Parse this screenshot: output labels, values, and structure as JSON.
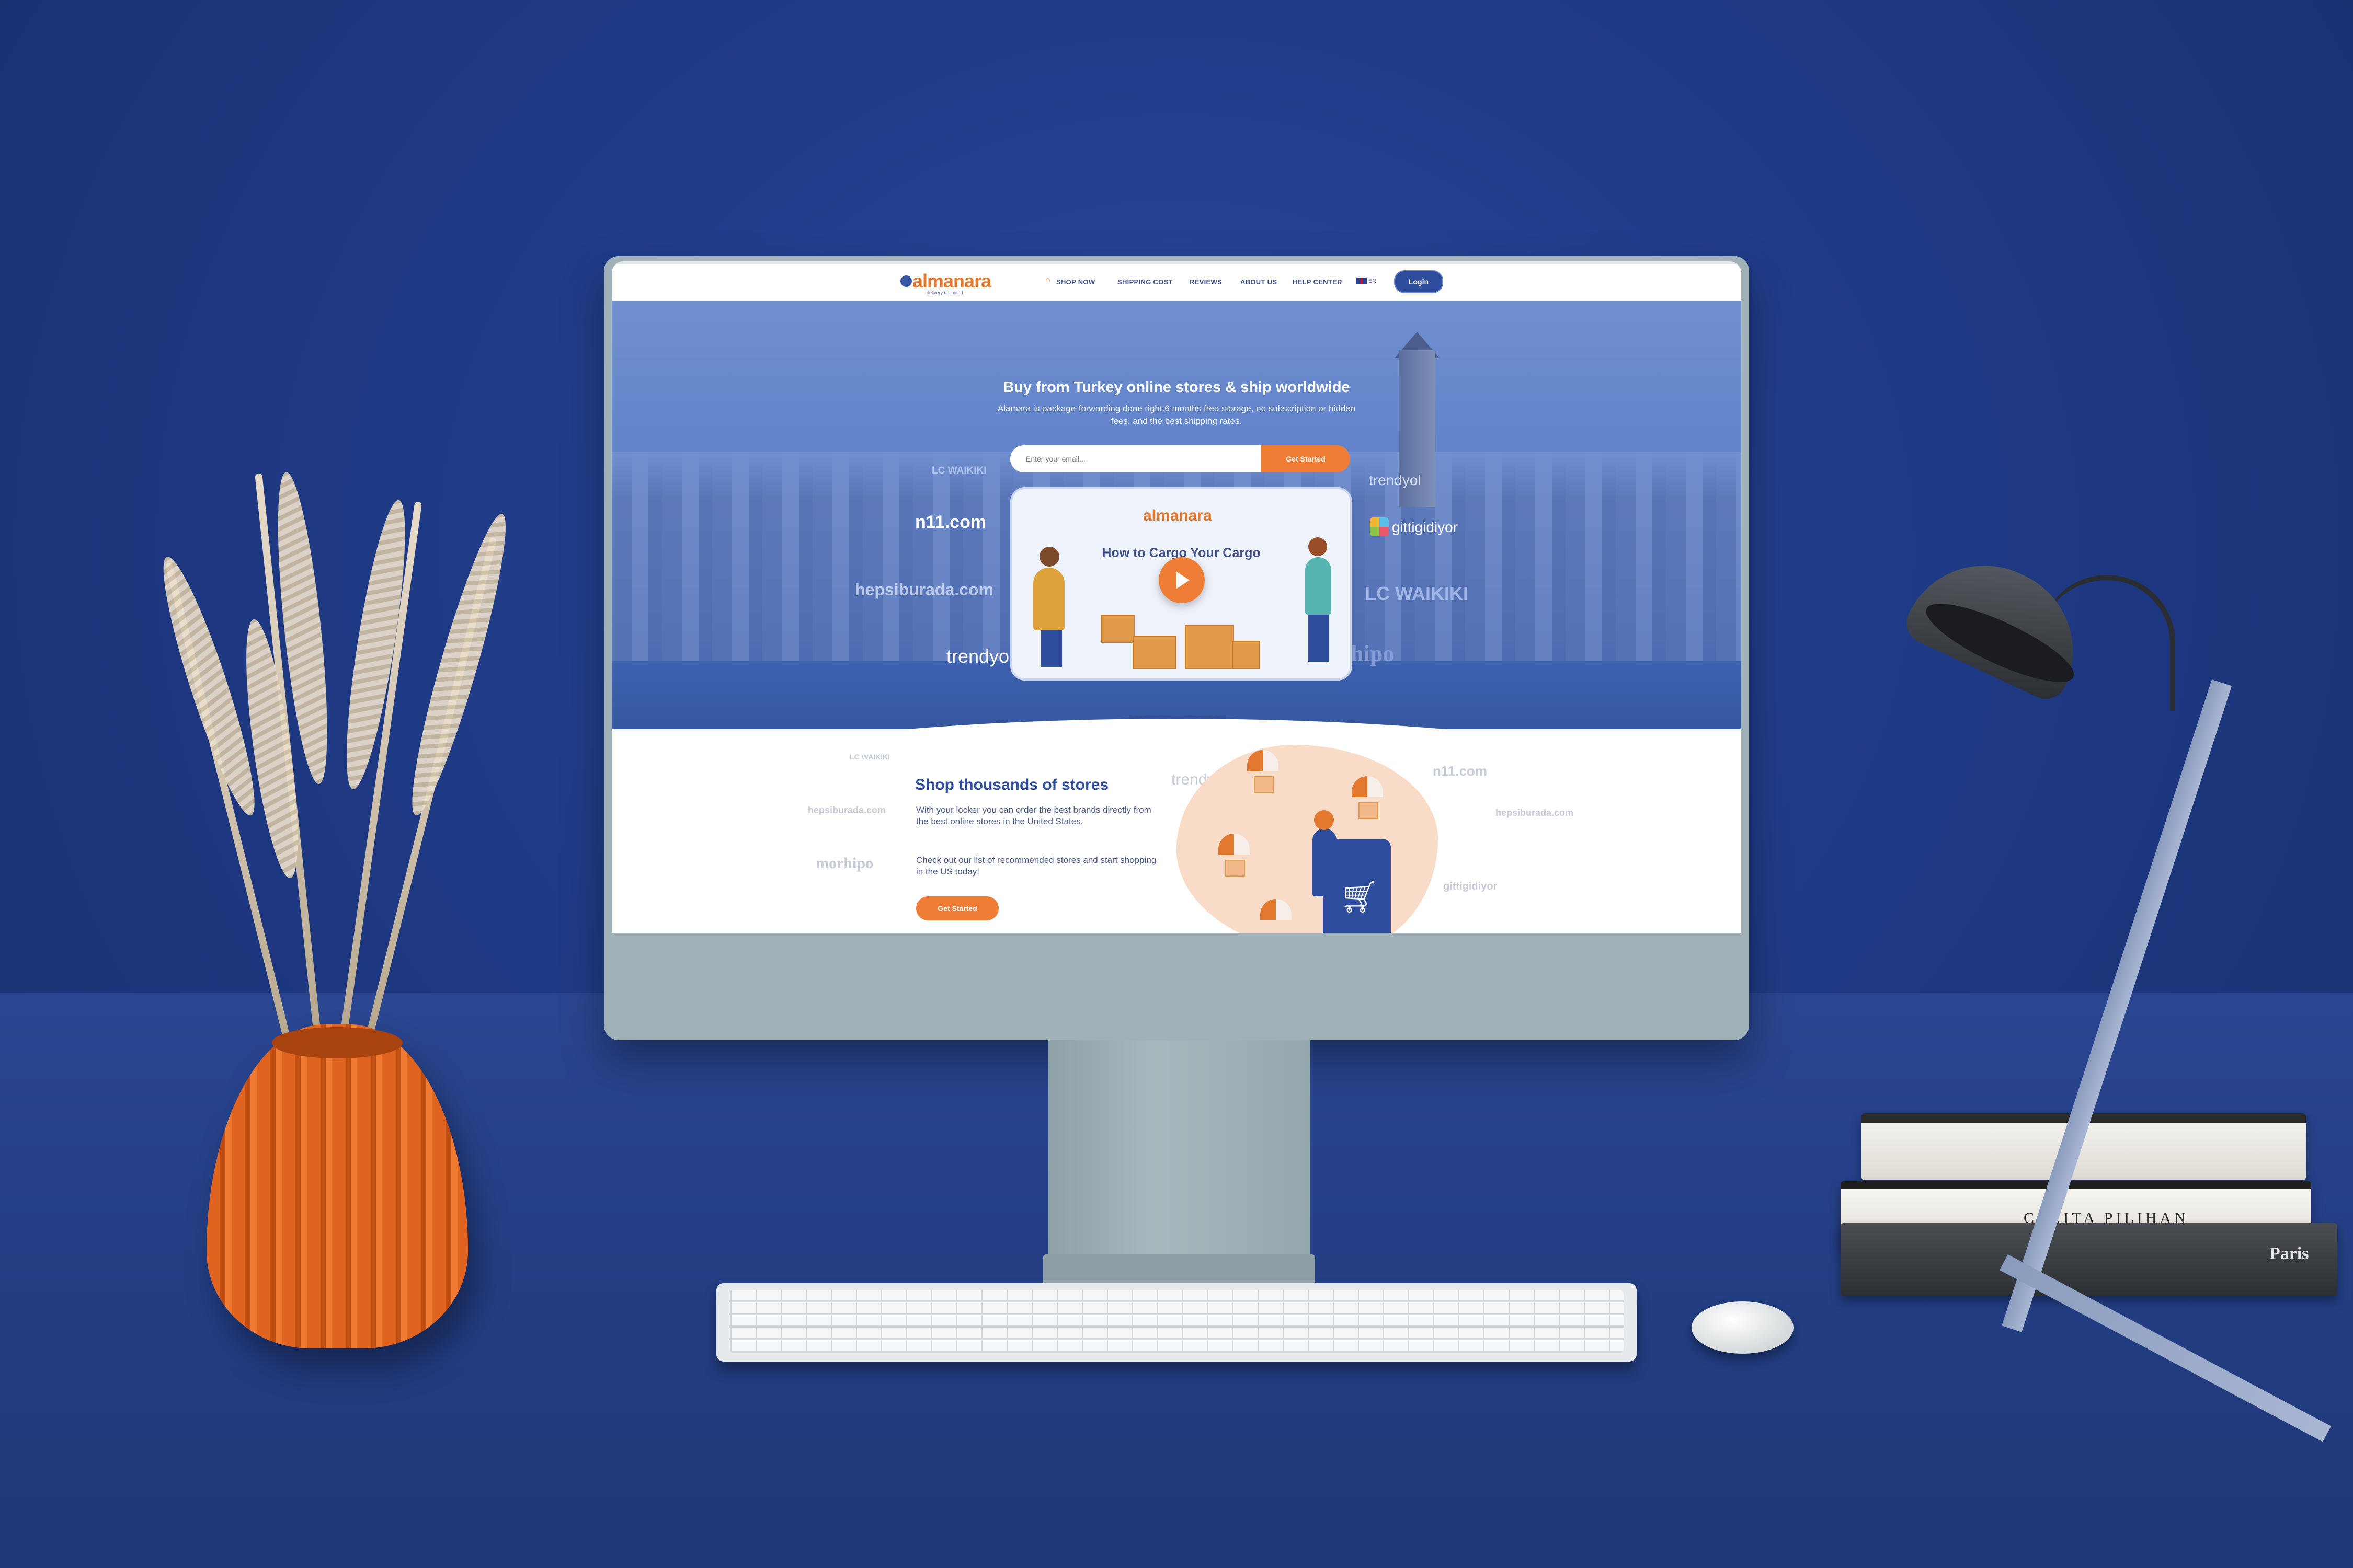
{
  "site": {
    "logo": "almanara",
    "logo_tagline": "delivery unlimited",
    "nav": [
      "SHOP NOW",
      "SHIPPING COST",
      "REVIEWS",
      "ABOUT US",
      "HELP CENTER"
    ],
    "lang": "EN",
    "login": "Login"
  },
  "hero": {
    "title": "Buy from Turkey online stores & ship worldwide",
    "subtitle": "Alamara is package-forwarding done right.6 months free storage, no subscription or hidden fees, and the best shipping rates.",
    "email_placeholder": "Enter your email...",
    "cta": "Get Started",
    "video_logo": "almanara",
    "video_title": "How to Cargo Your Cargo"
  },
  "brands": {
    "lcw": "LC WAIKIKI",
    "n11": "n11.com",
    "hepsiburada": "hepsiburada.com",
    "trendyol": "trendyol",
    "gittigidiyor": "gittigidiyor",
    "morhipo": "morhipo"
  },
  "section": {
    "title": "Shop thousands of stores",
    "text1": "With your locker you can order the best brands directly from the best online stores in the United States.",
    "text2": "Check out our list of recommended stores and start shopping in the US today!",
    "cta": "Get Started"
  },
  "books": {
    "spine2": "CERITA PILIHAN",
    "spine3": "Paris"
  }
}
